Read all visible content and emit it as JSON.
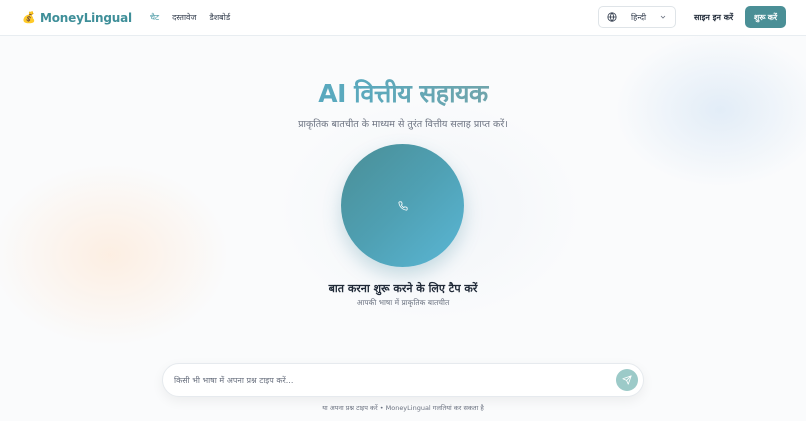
{
  "header": {
    "brand_icon": "money-bag-icon",
    "brand_name": "MoneyLingual",
    "nav": [
      {
        "label": "चैट",
        "active": true
      },
      {
        "label": "दस्तावेज",
        "active": false
      },
      {
        "label": "डैशबोर्ड",
        "active": false
      }
    ],
    "language": {
      "icon": "globe-icon",
      "selected": "हिन्दी",
      "chevron": "chevron-down-icon"
    },
    "signin_label": "साइन इन करें",
    "start_label": "शुरू करें"
  },
  "hero": {
    "title": "AI वित्तीय सहायक",
    "subtitle": "प्राकृतिक बातचीत के माध्यम से तुरंत वित्तीय सलाह प्राप्त करें।",
    "mic_icon": "phone-icon",
    "tap_label": "बात करना शुरू करने के लिए टैप करें",
    "tap_sub": "आपकी भाषा में प्राकृतिक बातचीत"
  },
  "composer": {
    "placeholder": "किसी भी भाषा में अपना प्रश्न टाइप करें...",
    "value": "",
    "send_icon": "send-icon"
  },
  "footer_note": "या अपना प्रश्न टाइप करें • MoneyLingual गलतियां कर सकता है",
  "colors": {
    "brand": "#3f8f99",
    "accent_button": "#4a8f96",
    "circle_start": "#4a8e96",
    "circle_end": "#5ab7d6",
    "send_button": "#9ccac8"
  }
}
